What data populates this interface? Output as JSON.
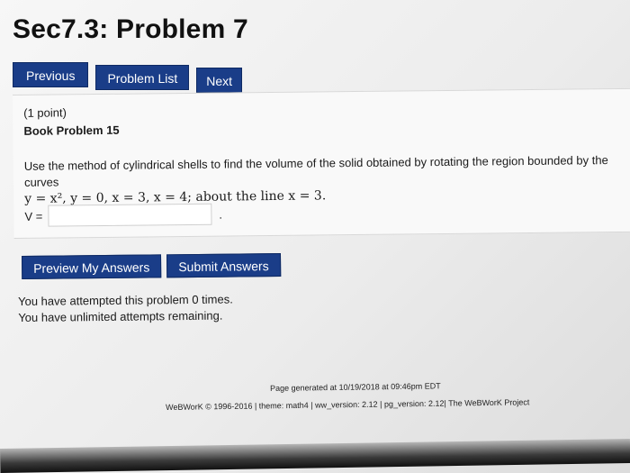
{
  "header": {
    "title": "Sec7.3: Problem 7"
  },
  "nav": {
    "previous_label": "Previous",
    "problem_list_label": "Problem List",
    "next_label": "Next"
  },
  "problem": {
    "points": "(1 point)",
    "book_problem": "Book Problem 15",
    "statement": "Use the method of cylindrical shells to find the volume of the solid obtained by rotating the region bounded by the curves",
    "curves": "y = x², y = 0, x = 3, x = 4; about the line x = 3.",
    "answer_label": "V =",
    "answer_value": "",
    "answer_suffix": "."
  },
  "actions": {
    "preview_label": "Preview My Answers",
    "submit_label": "Submit Answers"
  },
  "attempts": {
    "line1": "You have attempted this problem 0 times.",
    "line2": "You have unlimited attempts remaining."
  },
  "footer": {
    "generated": "Page generated at 10/19/2018 at 09:46pm EDT",
    "credits": "WeBWorK © 1996-2016 | theme: math4 | ww_version: 2.12 | pg_version: 2.12| The WeBWorK Project"
  }
}
